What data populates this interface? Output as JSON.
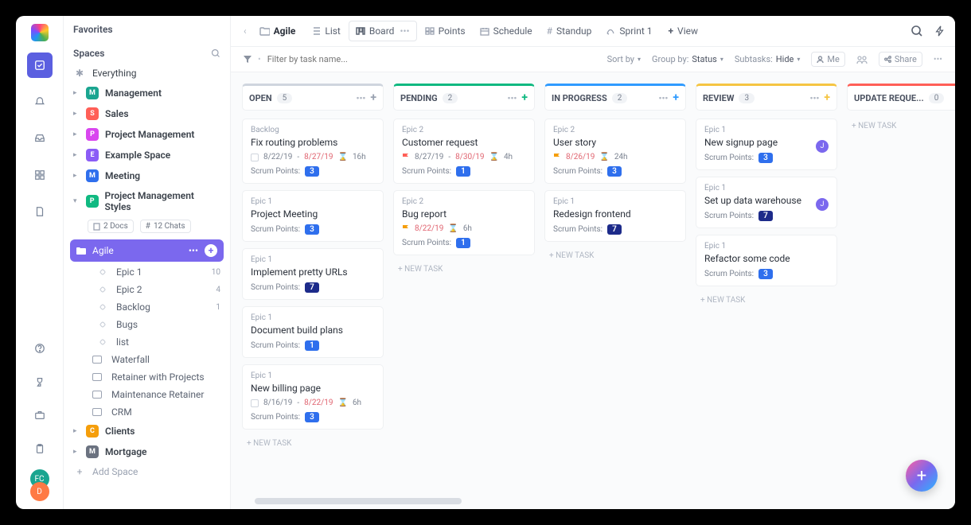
{
  "rail": {
    "avatars": [
      {
        "bg": "#1aa590",
        "t": "FC"
      },
      {
        "bg": "#ff7a45",
        "t": "D"
      }
    ]
  },
  "sidebar": {
    "favorites": "Favorites",
    "spaces": "Spaces",
    "everything": "Everything",
    "addSpace": "Add Space",
    "docs": "2 Docs",
    "chats": "12 Chats",
    "spacesList": [
      {
        "letter": "M",
        "color": "#1aa590",
        "label": "Management"
      },
      {
        "letter": "S",
        "color": "#ff5f57",
        "label": "Sales"
      },
      {
        "letter": "P",
        "color": "#d946ef",
        "label": "Project Management"
      },
      {
        "letter": "E",
        "color": "#8b5cf6",
        "label": "Example Space"
      },
      {
        "letter": "M",
        "color": "#2f6fed",
        "label": "Meeting"
      }
    ],
    "pmsLetter": "P",
    "pmsColor": "#10b981",
    "pms": "Project Management Styles",
    "active": "Agile",
    "lists": [
      {
        "label": "Epic 1",
        "count": "10"
      },
      {
        "label": "Epic 2",
        "count": "4"
      },
      {
        "label": "Backlog",
        "count": "1"
      },
      {
        "label": "Bugs",
        "count": ""
      },
      {
        "label": "list",
        "count": ""
      }
    ],
    "folders": [
      "Waterfall",
      "Retainer with Projects",
      "Maintenance Retainer",
      "CRM"
    ],
    "tailSpaces": [
      {
        "letter": "C",
        "color": "#f59e0b",
        "label": "Clients"
      },
      {
        "letter": "M",
        "color": "#6b7280",
        "label": "Mortgage"
      }
    ]
  },
  "topbar": {
    "title": "Agile",
    "views": [
      {
        "icon": "list",
        "label": "List"
      },
      {
        "icon": "board",
        "label": "Board",
        "active": true
      },
      {
        "icon": "points",
        "label": "Points"
      },
      {
        "icon": "schedule",
        "label": "Schedule"
      },
      {
        "icon": "standup",
        "label": "Standup"
      },
      {
        "icon": "sprint",
        "label": "Sprint 1"
      }
    ],
    "addView": "View"
  },
  "filterbar": {
    "placeholder": "Filter by task name...",
    "sort": "Sort by",
    "group": "Group by:",
    "groupVal": "Status",
    "subtasks": "Subtasks:",
    "subVal": "Hide",
    "me": "Me",
    "share": "Share"
  },
  "board": {
    "newTask": "+ NEW TASK",
    "spLabel": "Scrum Points:",
    "columns": [
      {
        "name": "OPEN",
        "count": "5",
        "color": "#cfd5de",
        "plus": "#9aa2b1",
        "cards": [
          {
            "epic": "Backlog",
            "title": "Fix routing problems",
            "d1": "8/22/19",
            "d2": "8/27/19",
            "time": "16h",
            "sp": "3",
            "flag": ""
          },
          {
            "epic": "Epic 1",
            "title": "Project Meeting",
            "sp": "3"
          },
          {
            "epic": "Epic 1",
            "title": "Implement pretty URLs",
            "sp": "7",
            "dark": true
          },
          {
            "epic": "Epic 1",
            "title": "Document build plans",
            "sp": "1"
          },
          {
            "epic": "Epic 1",
            "title": "New billing page",
            "d1": "8/16/19",
            "d2": "8/22/19",
            "time": "6h",
            "sp": "3",
            "flag": ""
          }
        ]
      },
      {
        "name": "PENDING",
        "count": "2",
        "color": "#10b981",
        "plus": "#10b981",
        "cards": [
          {
            "epic": "Epic 2",
            "title": "Customer request",
            "d1": "8/27/19",
            "d2": "8/30/19",
            "time": "4h",
            "sp": "1",
            "flag": "#ff5f57"
          },
          {
            "epic": "Epic 2",
            "title": "Bug report",
            "d1": "8/22/19",
            "time": "6h",
            "sp": "1",
            "flag": "#f59e0b",
            "d1red": true
          }
        ]
      },
      {
        "name": "IN PROGRESS",
        "count": "2",
        "color": "#2f9bff",
        "plus": "#2f9bff",
        "cards": [
          {
            "epic": "Epic 2",
            "title": "User story",
            "d1": "8/26/19",
            "time": "24h",
            "sp": "3",
            "flag": "#f59e0b",
            "d1red": true
          },
          {
            "epic": "Epic 1",
            "title": "Redesign frontend",
            "sp": "7",
            "dark": true
          }
        ]
      },
      {
        "name": "REVIEW",
        "count": "3",
        "color": "#f5c542",
        "plus": "#f5c542",
        "cards": [
          {
            "epic": "Epic 1",
            "title": "New signup page",
            "sp": "3",
            "asg": "J"
          },
          {
            "epic": "Epic 1",
            "title": "Set up data warehouse",
            "sp": "7",
            "dark": true,
            "asg": "J"
          },
          {
            "epic": "Epic 1",
            "title": "Refactor some code",
            "sp": "3"
          }
        ]
      },
      {
        "name": "UPDATE REQUE...",
        "count": "0",
        "color": "#ff5f57",
        "plus": "#ff5f57",
        "cards": []
      }
    ]
  }
}
